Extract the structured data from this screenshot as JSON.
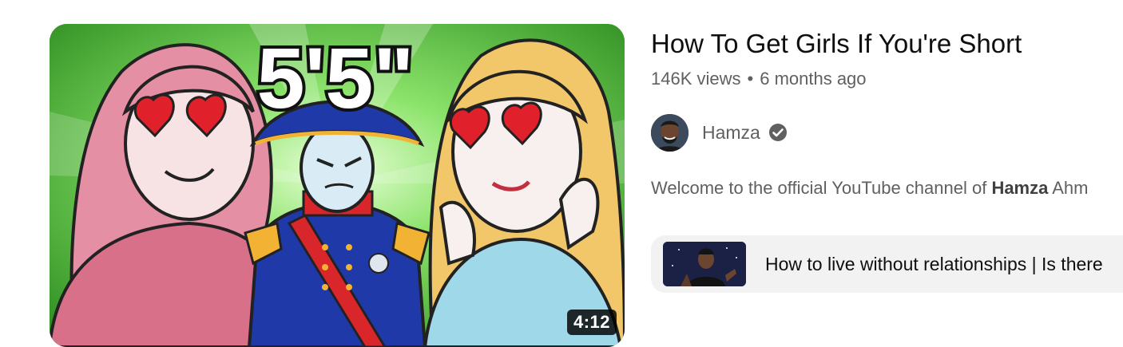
{
  "video": {
    "title": "How To Get Girls If You're Short",
    "views": "146K views",
    "separator": "•",
    "age": "6 months ago",
    "duration": "4:12",
    "thumbnail_text": "5'5\""
  },
  "channel": {
    "name": "Hamza",
    "verified": true
  },
  "description": {
    "prefix": "Welcome to the official YouTube channel of ",
    "bold": "Hamza",
    "suffix": " Ahm"
  },
  "related_chapter": {
    "title": "How to live without relationships | Is there"
  },
  "colors": {
    "title": "#0f0f0f",
    "secondary_text": "#606060",
    "chip_background": "#f2f2f2",
    "thumbnail_background": "#3a9a2a",
    "duration_badge": "#000000"
  },
  "icons": {
    "verified": "verified-check-icon"
  }
}
